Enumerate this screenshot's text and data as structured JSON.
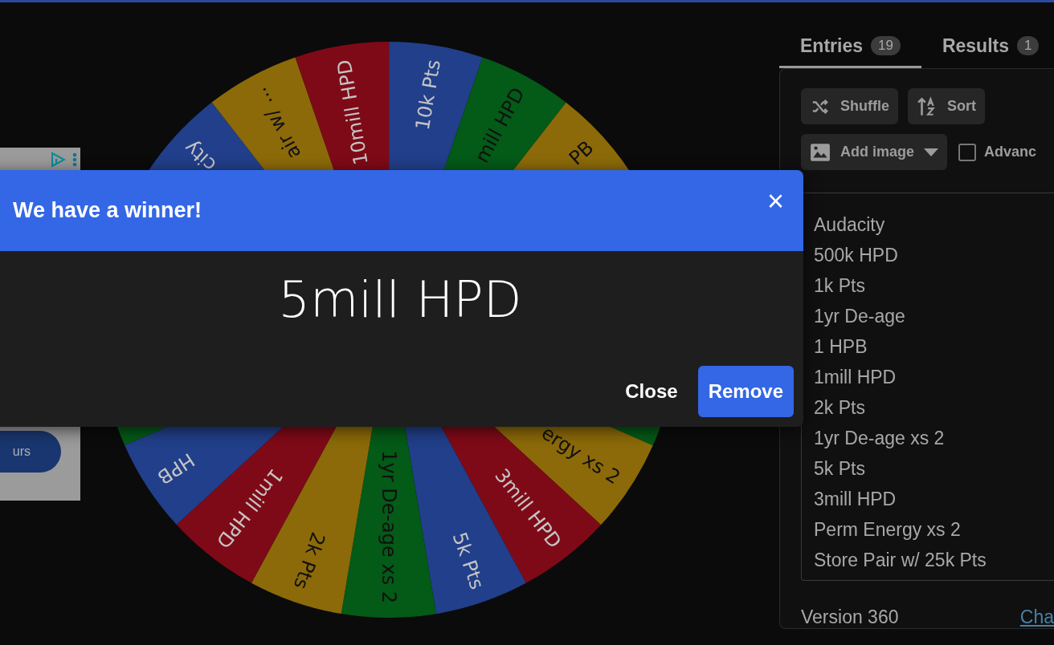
{
  "wheel": {
    "upper_right_arc": [
      {
        "color": "#213f8a",
        "label": "10k Pts"
      },
      {
        "color": "#045a17",
        "label": "mill HPD"
      },
      {
        "color": "#8c6a09",
        "label": "PB"
      }
    ],
    "lower_arc": [
      {
        "color": "#045a17"
      },
      {
        "color": "#8c6a09",
        "label": "ergy xs 2"
      },
      {
        "color": "#7f0a17",
        "label": "3mill HPD"
      },
      {
        "color": "#213f8a",
        "label": "5k Pts"
      },
      {
        "color": "#045a17",
        "label": "1yr De-age xs 2"
      },
      {
        "color": "#8c6a09",
        "label": "2k Pts"
      },
      {
        "color": "#7f0a17",
        "label": "1mill HPD"
      },
      {
        "color": "#213f8a",
        "label": "HPB"
      },
      {
        "color": "#045a17"
      }
    ],
    "upper_left_arc": [
      {
        "color": "#213f8a",
        "label": "city"
      },
      {
        "color": "#8c6a09",
        "label": "air w/ ..."
      },
      {
        "color": "#7f0a17",
        "label": "10mill HPD"
      }
    ]
  },
  "ad": {
    "button": "urs"
  },
  "dialog": {
    "title": "We have a winner!",
    "close": "×",
    "winner": "5mill HPD",
    "buttons": [
      {
        "label": "Close",
        "kind": "text"
      },
      {
        "label": "Remove",
        "kind": "primary"
      }
    ]
  },
  "sidebar": {
    "tabs": [
      {
        "label": "Entries",
        "count": "19",
        "selected": true
      },
      {
        "label": "Results",
        "count": "1",
        "selected": false
      }
    ],
    "actions": [
      {
        "label": "Shuffle",
        "kind": "shuffle"
      },
      {
        "label": "Sort",
        "kind": "sort"
      }
    ],
    "add_image": "Add image",
    "advanced": {
      "label": "Advanc",
      "checked": false
    },
    "entries": [
      "Audacity",
      "500k HPD",
      "1k Pts",
      "1yr De-age",
      "1 HPB",
      "1mill HPD",
      "2k Pts",
      "1yr De-age xs 2",
      "5k Pts",
      "3mill HPD",
      "Perm Energy xs 2",
      "Store Pair w/ 25k Pts"
    ],
    "version": "Version 360",
    "link": "Cha"
  }
}
